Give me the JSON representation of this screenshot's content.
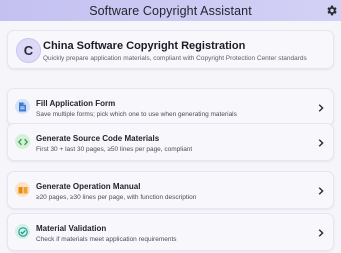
{
  "window": {
    "title": "Software Copyright Assistant"
  },
  "hero": {
    "logo_letter": "C",
    "title": "China Software Copyright Registration",
    "subtitle": "Quickly prepare application materials, compliant with Copyright Protection Center standards"
  },
  "menu": [
    {
      "title": "Fill Application Form",
      "subtitle": "Save multiple forms; pick which one to use when generating materials",
      "icon": "document-icon",
      "accent": "#3a7bd5"
    },
    {
      "title": "Generate Source Code Materials",
      "subtitle": "First 30 + last 30 pages, ≥50 lines per page, compliant",
      "icon": "code-icon",
      "accent": "#2f9e44"
    },
    {
      "title": "Generate Operation Manual",
      "subtitle": "≥20 pages, ≥30 lines per page, with function description",
      "icon": "book-icon",
      "accent": "#e8890c"
    },
    {
      "title": "Material Validation",
      "subtitle": "Check if materials meet application requirements",
      "icon": "check-circle-icon",
      "accent": "#12a085"
    }
  ]
}
